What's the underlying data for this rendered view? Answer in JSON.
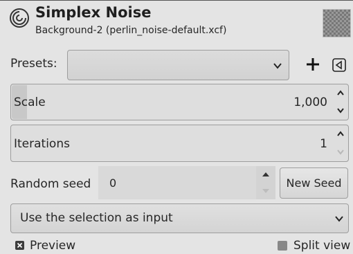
{
  "header": {
    "title": "Simplex Noise",
    "subtitle": "Background-2 (perlin_noise-default.xcf)",
    "icon": "gegl-filter-icon"
  },
  "presets": {
    "label": "Presets:",
    "selected": "",
    "add_icon": "plus-icon",
    "menu_icon": "triangle-left-menu-icon"
  },
  "scale": {
    "label": "Scale",
    "value": "1,000"
  },
  "iterations": {
    "label": "Iterations",
    "value": "1"
  },
  "seed": {
    "label": "Random seed",
    "value": "0",
    "new_seed_label": "New Seed"
  },
  "input": {
    "selected": "Use the selection as input"
  },
  "preview": {
    "label": "Preview",
    "checked": true
  },
  "split_view": {
    "label": "Split view",
    "checked": false
  }
}
